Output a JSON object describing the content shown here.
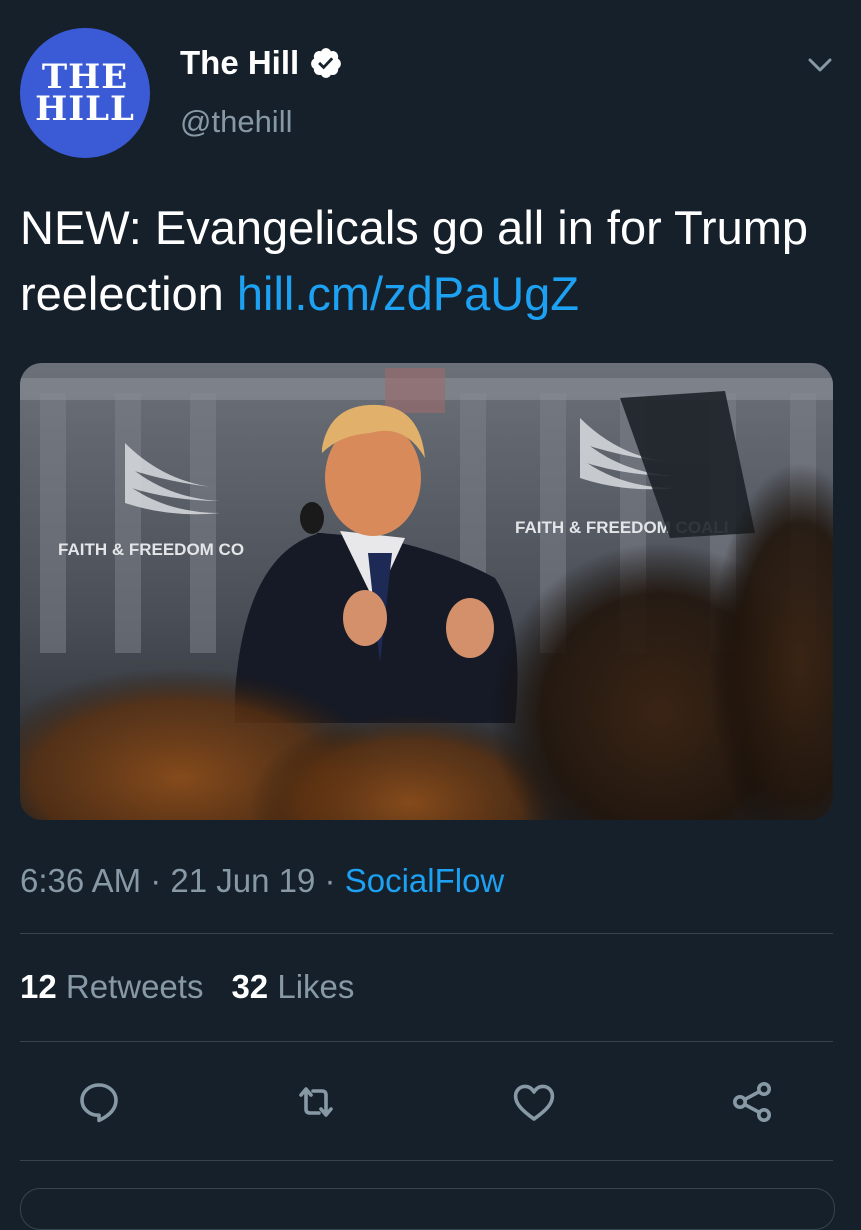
{
  "author": {
    "avatar_line1": "THE",
    "avatar_line2": "HILL",
    "display_name": "The Hill",
    "handle": "@thehill"
  },
  "tweet": {
    "text": "NEW: Evangelicals go all in for Trump reelection ",
    "link": "hill.cm/zdPaUgZ"
  },
  "media": {
    "banner_left": "FAITH & FREEDOM CO",
    "banner_right": "FAITH & FREEDOM COALI"
  },
  "meta": {
    "time": "6:36 AM",
    "sep1": " · ",
    "date": "21 Jun 19",
    "sep2": " · ",
    "source": "SocialFlow"
  },
  "stats": {
    "retweets_count": "12",
    "retweets_label": " Retweets",
    "likes_count": "32",
    "likes_label": " Likes"
  },
  "icons": {
    "verified": "verified-badge-icon",
    "caret": "chevron-down-icon",
    "reply": "reply-icon",
    "retweet": "retweet-icon",
    "like": "heart-icon",
    "share": "share-icon"
  },
  "colors": {
    "background": "#15202b",
    "link": "#1da1f2",
    "secondary_text": "#8899a6",
    "avatar_bg": "#3b5bd6"
  }
}
